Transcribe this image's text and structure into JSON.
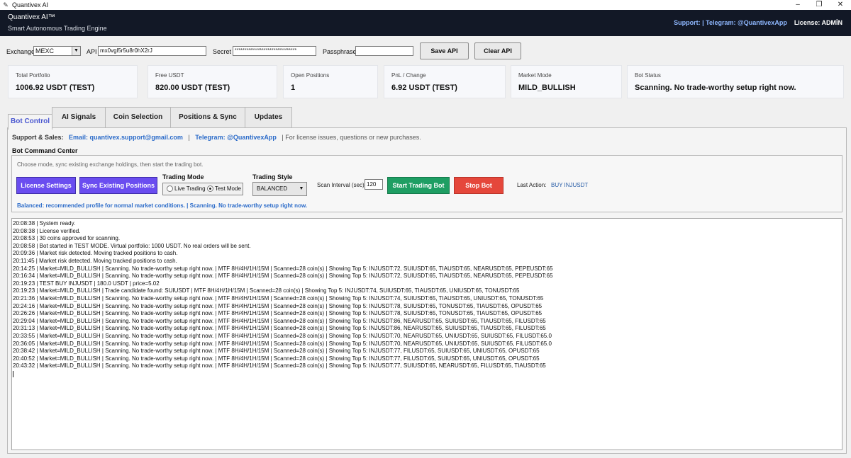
{
  "window": {
    "title": "Quantivex AI",
    "controls": [
      "–",
      "❐",
      "✕"
    ]
  },
  "header": {
    "app_name": "Quantivex AI™",
    "subtitle": "Smart Autonomous Trading Engine",
    "support": "Support:  | Telegram: @QuantivexApp",
    "license": "License: ADMİN"
  },
  "api": {
    "exchange_label": "Exchange",
    "exchange_value": "MEXC",
    "api_label": "API",
    "api_value": "mx0vgl5r5u8r0hX2rJ",
    "secret_label": "Secret",
    "secret_value": "********************************",
    "passphrase_label": "Passphrase",
    "passphrase_value": "",
    "save_label": "Save API",
    "clear_label": "Clear API"
  },
  "stats": [
    {
      "label": "Total Portfolio",
      "value": "1006.92 USDT (TEST)"
    },
    {
      "label": "Free USDT",
      "value": "820.00 USDT (TEST)"
    },
    {
      "label": "Open Positions",
      "value": "1"
    },
    {
      "label": "PnL / Change",
      "value": "6.92 USDT (TEST)"
    },
    {
      "label": "Market Mode",
      "value": "MILD_BULLISH"
    },
    {
      "label": "Bot Status",
      "value": "Scanning. No trade-worthy setup right now."
    }
  ],
  "tabs": [
    "Bot Control",
    "AI Signals",
    "Coin Selection",
    "Positions & Sync",
    "Updates"
  ],
  "sales": {
    "label": "Support & Sales:",
    "email": "Email: quantivex.support@gmail.com",
    "sep": "|",
    "telegram": "Telegram: @QuantivexApp",
    "note": "|  For license issues, questions or new purchases."
  },
  "command": {
    "title": "Bot Command Center",
    "hint": "Choose mode, sync existing exchange holdings, then start the trading bot.",
    "license_btn": "License Settings",
    "sync_btn": "Sync Existing Positions",
    "mode_label": "Trading Mode",
    "live_label": "Live Trading",
    "test_label": "Test Mode",
    "selected_mode": "Test Mode",
    "style_label": "Trading Style",
    "style_value": "BALANCED",
    "scan_label": "Scan Interval (sec)",
    "scan_value": "120",
    "start_btn": "Start Trading Bot",
    "stop_btn": "Stop Bot",
    "last_action_label": "Last Action:",
    "last_action_value": "BUY INJUSDT",
    "status_line": "Balanced: recommended profile for normal market conditions. | Scanning. No trade-worthy setup right now."
  },
  "log": [
    "20:08:38 | System ready.",
    "20:08:38 | License verified.",
    "20:08:53 | 30 coins approved for scanning.",
    "20:08:58 | Bot started in TEST MODE. Virtual portfolio: 1000 USDT. No real orders will be sent.",
    "20:09:36 | Market risk detected. Moving tracked positions to cash.",
    "20:11:45 | Market risk detected. Moving tracked positions to cash.",
    "20:14:25 | Market=MILD_BULLISH | Scanning. No trade-worthy setup right now. | MTF 8H/4H/1H/15M | Scanned=28 coin(s) | Showing Top 5: INJUSDT:72, SUIUSDT:65, TIAUSDT:65, NEARUSDT:65, PEPEUSDT:65",
    "20:16:34 | Market=MILD_BULLISH | Scanning. No trade-worthy setup right now. | MTF 8H/4H/1H/15M | Scanned=28 coin(s) | Showing Top 5: INJUSDT:72, SUIUSDT:65, TIAUSDT:65, NEARUSDT:65, PEPEUSDT:65",
    "20:19:23 | TEST BUY INJUSDT | 180.0 USDT | price=5.02",
    "20:19:23 | Market=MILD_BULLISH | Trade candidate found: SUIUSDT | MTF 8H/4H/1H/15M | Scanned=28 coin(s) | Showing Top 5: INJUSDT:74, SUIUSDT:65, TIAUSDT:65, UNIUSDT:65, TONUSDT:65",
    "20:21:36 | Market=MILD_BULLISH | Scanning. No trade-worthy setup right now. | MTF 8H/4H/1H/15M | Scanned=28 coin(s) | Showing Top 5: INJUSDT:74, SUIUSDT:65, TIAUSDT:65, UNIUSDT:65, TONUSDT:65",
    "20:24:16 | Market=MILD_BULLISH | Scanning. No trade-worthy setup right now. | MTF 8H/4H/1H/15M | Scanned=28 coin(s) | Showing Top 5: INJUSDT:78, SUIUSDT:65, TONUSDT:65, TIAUSDT:65, OPUSDT:65",
    "20:26:26 | Market=MILD_BULLISH | Scanning. No trade-worthy setup right now. | MTF 8H/4H/1H/15M | Scanned=28 coin(s) | Showing Top 5: INJUSDT:78, SUIUSDT:65, TONUSDT:65, TIAUSDT:65, OPUSDT:65",
    "20:29:04 | Market=MILD_BULLISH | Scanning. No trade-worthy setup right now. | MTF 8H/4H/1H/15M | Scanned=28 coin(s) | Showing Top 5: INJUSDT:86, NEARUSDT:65, SUIUSDT:65, TIAUSDT:65, FILUSDT:65",
    "20:31:13 | Market=MILD_BULLISH | Scanning. No trade-worthy setup right now. | MTF 8H/4H/1H/15M | Scanned=28 coin(s) | Showing Top 5: INJUSDT:86, NEARUSDT:65, SUIUSDT:65, TIAUSDT:65, FILUSDT:65",
    "20:33:55 | Market=MILD_BULLISH | Scanning. No trade-worthy setup right now. | MTF 8H/4H/1H/15M | Scanned=28 coin(s) | Showing Top 5: INJUSDT:70, NEARUSDT:65, UNIUSDT:65, SUIUSDT:65, FILUSDT:65.0",
    "20:36:05 | Market=MILD_BULLISH | Scanning. No trade-worthy setup right now. | MTF 8H/4H/1H/15M | Scanned=28 coin(s) | Showing Top 5: INJUSDT:70, NEARUSDT:65, UNIUSDT:65, SUIUSDT:65, FILUSDT:65.0",
    "20:38:42 | Market=MILD_BULLISH | Scanning. No trade-worthy setup right now. | MTF 8H/4H/1H/15M | Scanned=28 coin(s) | Showing Top 5: INJUSDT:77, FILUSDT:65, SUIUSDT:65, UNIUSDT:65, OPUSDT:65",
    "20:40:52 | Market=MILD_BULLISH | Scanning. No trade-worthy setup right now. | MTF 8H/4H/1H/15M | Scanned=28 coin(s) | Showing Top 5: INJUSDT:77, FILUSDT:65, SUIUSDT:65, UNIUSDT:65, OPUSDT:65",
    "20:43:32 | Market=MILD_BULLISH | Scanning. No trade-worthy setup right now. | MTF 8H/4H/1H/15M | Scanned=28 coin(s) | Showing Top 5: INJUSDT:77, SUIUSDT:65, NEARUSDT:65, FILUSDT:65, TIAUSDT:65"
  ]
}
